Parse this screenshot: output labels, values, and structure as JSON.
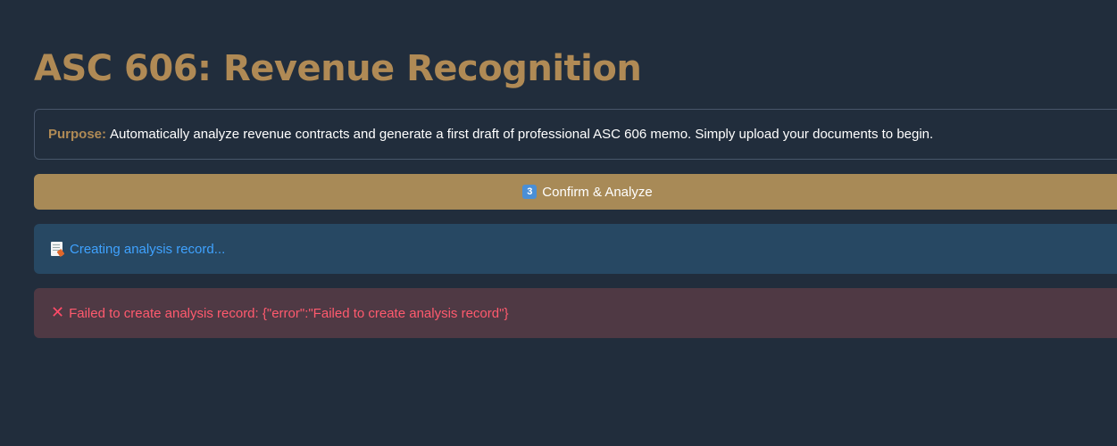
{
  "page": {
    "title": "ASC 606: Revenue Recognition"
  },
  "purpose": {
    "label": "Purpose:",
    "text": "Automatically analyze revenue contracts and generate a first draft of professional ASC 606 memo. Simply upload your documents to begin."
  },
  "confirm_button": {
    "step_icon": "keycap-3-icon",
    "step_number": "3",
    "label": "Confirm & Analyze"
  },
  "status_info": {
    "icon": "memo-icon",
    "text": "Creating analysis record..."
  },
  "status_error": {
    "icon": "cross-mark-icon",
    "glyph": "✕",
    "text": "Failed to create analysis record: {\"error\":\"Failed to create analysis record\"}"
  },
  "colors": {
    "background": "#212d3c",
    "accent": "#b08a55",
    "button": "#a88a57",
    "info_bg": "#274863",
    "info_text": "#3fa2ff",
    "error_bg": "#4f3944",
    "error_text": "#ff5a6e"
  }
}
